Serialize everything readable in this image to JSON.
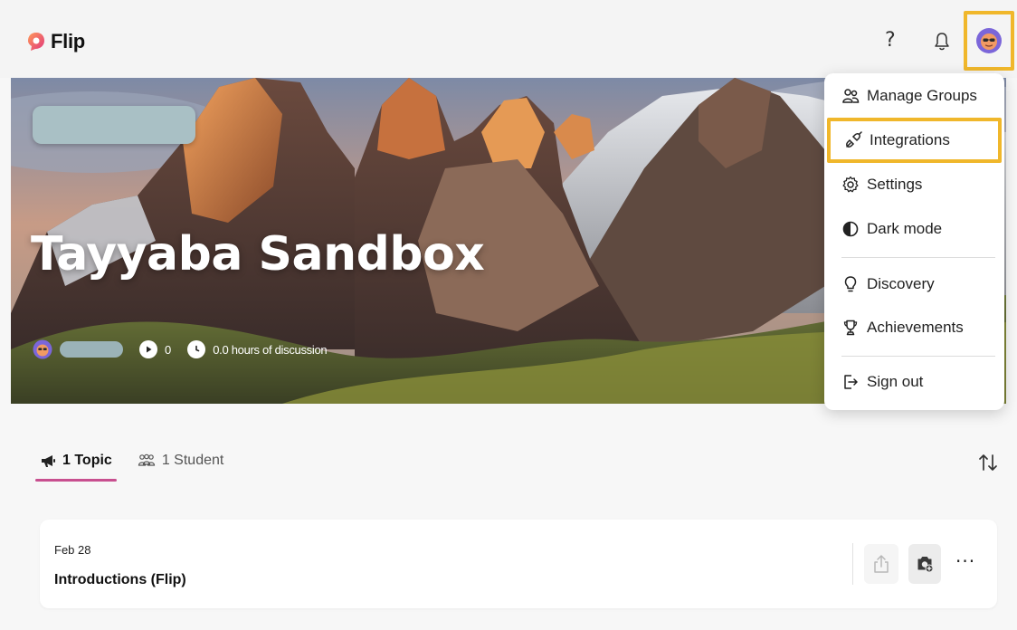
{
  "app": {
    "name": "Flip"
  },
  "header": {
    "help_label": "?"
  },
  "banner": {
    "title": "Tayyaba Sandbox",
    "video_count": "0",
    "hours_text": "0.0 hours of discussion"
  },
  "menu": {
    "items": [
      {
        "label": "Manage Groups",
        "icon": "people-group-icon"
      },
      {
        "label": "Integrations",
        "icon": "plug-icon"
      },
      {
        "label": "Settings",
        "icon": "gear-icon"
      },
      {
        "label": "Dark mode",
        "icon": "contrast-icon"
      },
      {
        "label": "Discovery",
        "icon": "lightbulb-icon"
      },
      {
        "label": "Achievements",
        "icon": "trophy-icon"
      },
      {
        "label": "Sign out",
        "icon": "sign-out-icon"
      }
    ]
  },
  "tabs": [
    {
      "label": "1 Topic",
      "icon": "megaphone-icon",
      "active": true
    },
    {
      "label": "1 Student",
      "icon": "students-icon",
      "active": false
    }
  ],
  "topic": {
    "date": "Feb 28",
    "title": "Introductions (Flip)",
    "more_label": "···"
  },
  "colors": {
    "highlight": "#f0b72b",
    "tab_underline": "#c84f8f",
    "brand_pink": "#ee5a7a"
  }
}
